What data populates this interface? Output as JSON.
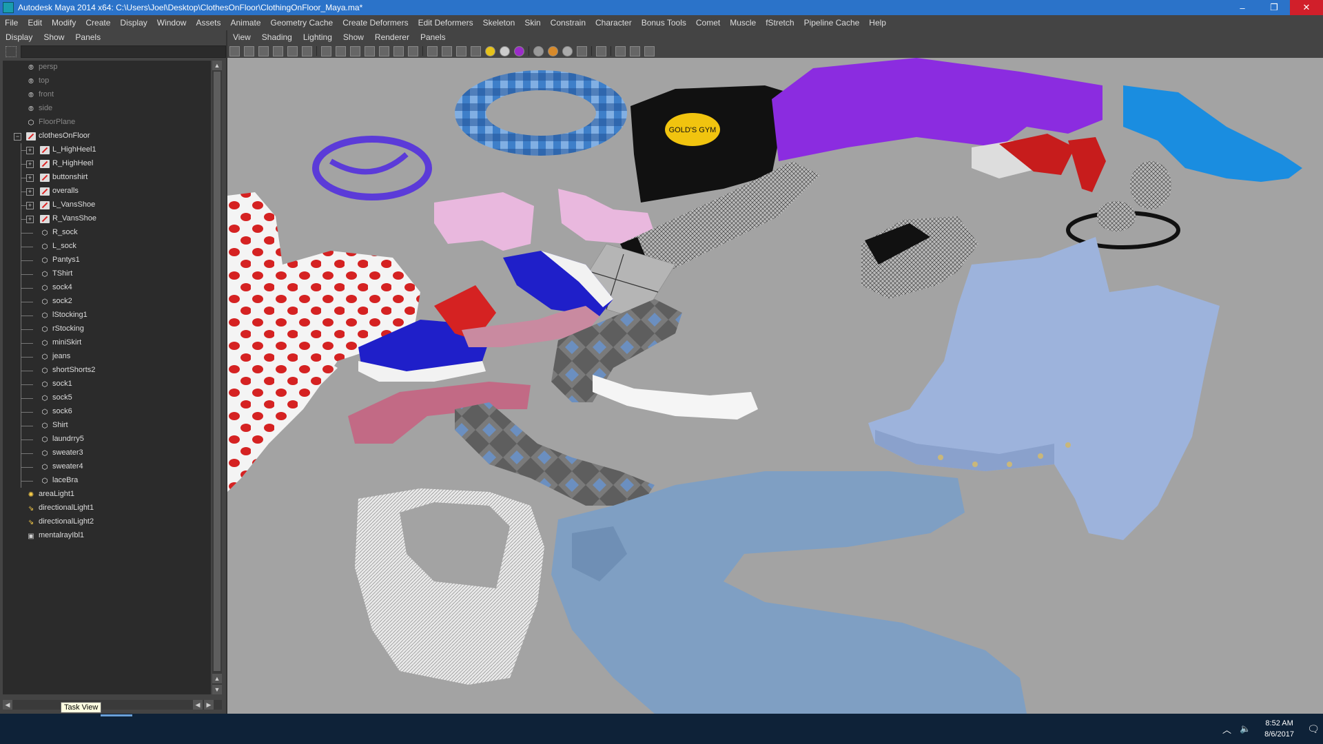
{
  "window": {
    "title": "Autodesk Maya 2014 x64: C:\\Users\\Joel\\Desktop\\ClothesOnFloor\\ClothingOnFloor_Maya.ma*",
    "minimize": "–",
    "maximize": "❐",
    "close": "✕"
  },
  "menubar": [
    "File",
    "Edit",
    "Modify",
    "Create",
    "Display",
    "Window",
    "Assets",
    "Animate",
    "Geometry Cache",
    "Create Deformers",
    "Edit Deformers",
    "Skeleton",
    "Skin",
    "Constrain",
    "Character",
    "Bonus Tools",
    "Comet",
    "Muscle",
    "fStretch",
    "Pipeline Cache",
    "Help"
  ],
  "outliner": {
    "menu": [
      "Display",
      "Show",
      "Panels"
    ],
    "items": [
      {
        "label": "persp",
        "icon": "camera-icon",
        "depth": 0,
        "dim": true
      },
      {
        "label": "top",
        "icon": "camera-icon",
        "depth": 0,
        "dim": true
      },
      {
        "label": "front",
        "icon": "camera-icon",
        "depth": 0,
        "dim": true
      },
      {
        "label": "side",
        "icon": "camera-icon",
        "depth": 0,
        "dim": true
      },
      {
        "label": "FloorPlane",
        "icon": "mesh-icon",
        "depth": 0,
        "dim": true
      },
      {
        "label": "clothesOnFloor",
        "icon": "group-icon",
        "depth": 0,
        "expander": "minus"
      },
      {
        "label": "L_HighHeel1",
        "icon": "group-icon",
        "depth": 1,
        "expander": "plus"
      },
      {
        "label": "R_HighHeel",
        "icon": "group-icon",
        "depth": 1,
        "expander": "plus"
      },
      {
        "label": "buttonshirt",
        "icon": "group-icon",
        "depth": 1,
        "expander": "plus"
      },
      {
        "label": "overalls",
        "icon": "group-icon",
        "depth": 1,
        "expander": "plus"
      },
      {
        "label": "L_VansShoe",
        "icon": "group-icon",
        "depth": 1,
        "expander": "plus"
      },
      {
        "label": "R_VansShoe",
        "icon": "group-icon",
        "depth": 1,
        "expander": "plus"
      },
      {
        "label": "R_sock",
        "icon": "mesh-icon",
        "depth": 1
      },
      {
        "label": "L_sock",
        "icon": "mesh-icon",
        "depth": 1
      },
      {
        "label": "Pantys1",
        "icon": "mesh-icon",
        "depth": 1
      },
      {
        "label": "TShirt",
        "icon": "mesh-icon",
        "depth": 1
      },
      {
        "label": "sock4",
        "icon": "mesh-icon",
        "depth": 1
      },
      {
        "label": "sock2",
        "icon": "mesh-icon",
        "depth": 1
      },
      {
        "label": "lStocking1",
        "icon": "mesh-icon",
        "depth": 1
      },
      {
        "label": "rStocking",
        "icon": "mesh-icon",
        "depth": 1
      },
      {
        "label": "miniSkirt",
        "icon": "mesh-icon",
        "depth": 1
      },
      {
        "label": "jeans",
        "icon": "mesh-icon",
        "depth": 1
      },
      {
        "label": "shortShorts2",
        "icon": "mesh-icon",
        "depth": 1
      },
      {
        "label": "sock1",
        "icon": "mesh-icon",
        "depth": 1
      },
      {
        "label": "sock5",
        "icon": "mesh-icon",
        "depth": 1
      },
      {
        "label": "sock6",
        "icon": "mesh-icon",
        "depth": 1
      },
      {
        "label": "Shirt",
        "icon": "mesh-icon",
        "depth": 1
      },
      {
        "label": "laundrry5",
        "icon": "mesh-icon",
        "depth": 1
      },
      {
        "label": "sweater3",
        "icon": "mesh-icon",
        "depth": 1
      },
      {
        "label": "sweater4",
        "icon": "mesh-icon",
        "depth": 1
      },
      {
        "label": "laceBra",
        "icon": "mesh-icon",
        "depth": 1
      },
      {
        "label": "areaLight1",
        "icon": "area-light-icon",
        "depth": 0
      },
      {
        "label": "directionalLight1",
        "icon": "directional-light-icon",
        "depth": 0
      },
      {
        "label": "directionalLight2",
        "icon": "directional-light-icon",
        "depth": 0
      },
      {
        "label": "mentalrayIbl1",
        "icon": "ibl-icon",
        "depth": 0
      }
    ]
  },
  "tooltip": "Task View",
  "panel_menu": [
    "View",
    "Shading",
    "Lighting",
    "Show",
    "Renderer",
    "Panels"
  ],
  "viewport": {
    "background": "#a3a3a3",
    "tshirt_logo": "GOLD'S GYM"
  },
  "taskbar": {
    "time": "8:52 AM",
    "date": "8/6/2017"
  }
}
